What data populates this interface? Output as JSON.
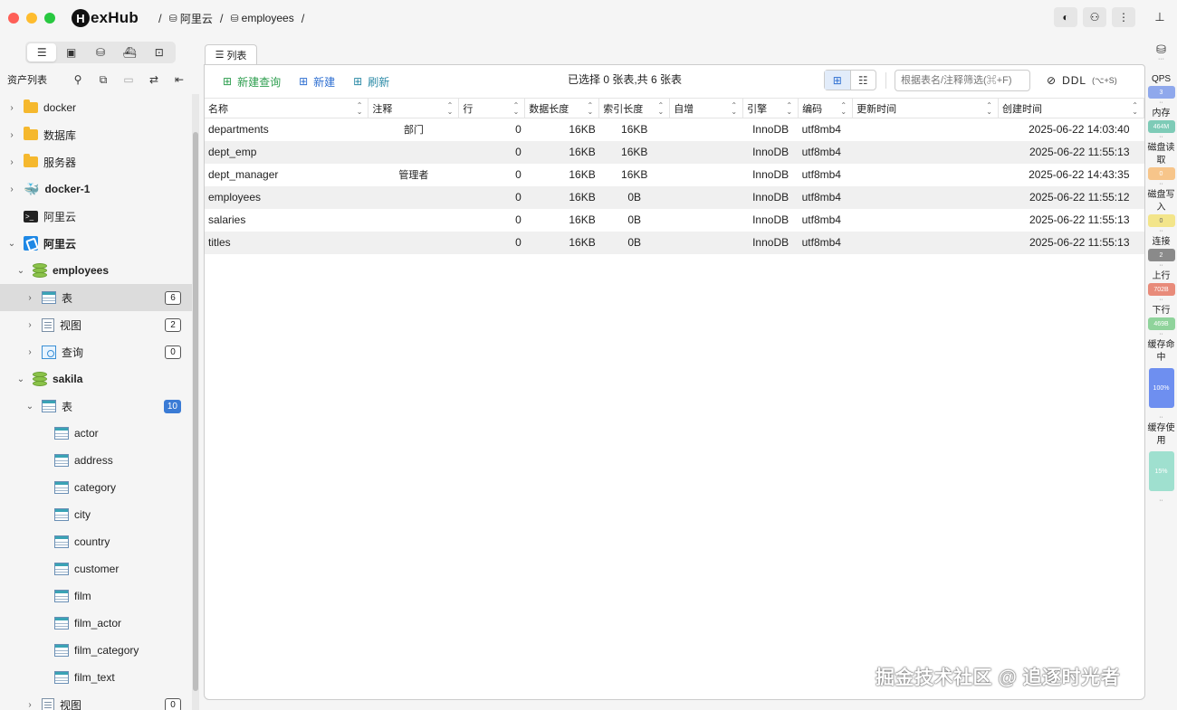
{
  "app": {
    "logo_letter": "H",
    "logo_rest": "exHub"
  },
  "breadcrumb": {
    "sep": "/",
    "item1": "阿里云",
    "item2": "employees"
  },
  "sidebar": {
    "header_label": "资产列表",
    "tree": [
      {
        "label": "docker",
        "icon": "folder",
        "chevron": "›",
        "level": 0,
        "bold": false
      },
      {
        "label": "数据库",
        "icon": "folder",
        "chevron": "›",
        "level": 0,
        "bold": false
      },
      {
        "label": "服务器",
        "icon": "folder",
        "chevron": "›",
        "level": 0,
        "bold": false
      },
      {
        "label": "docker-1",
        "icon": "docker",
        "chevron": "›",
        "level": 0,
        "bold": true
      },
      {
        "label": "阿里云",
        "icon": "terminal",
        "chevron": "",
        "level": 0,
        "bold": false
      },
      {
        "label": "阿里云",
        "icon": "aliyun",
        "chevron": "⌄",
        "level": 0,
        "bold": true
      },
      {
        "label": "employees",
        "icon": "database",
        "chevron": "⌄",
        "level": 1,
        "bold": true
      },
      {
        "label": "表",
        "icon": "table",
        "chevron": "›",
        "level": 2,
        "bold": false,
        "badge": "6",
        "selected": true
      },
      {
        "label": "视图",
        "icon": "view",
        "chevron": "›",
        "level": 2,
        "bold": false,
        "badge": "2"
      },
      {
        "label": "查询",
        "icon": "query",
        "chevron": "›",
        "level": 2,
        "bold": false,
        "badge": "0"
      },
      {
        "label": "sakila",
        "icon": "database",
        "chevron": "⌄",
        "level": 1,
        "bold": true
      },
      {
        "label": "表",
        "icon": "table",
        "chevron": "⌄",
        "level": 2,
        "bold": false,
        "badge": "10",
        "badge_blue": true
      },
      {
        "label": "actor",
        "icon": "table",
        "chevron": "",
        "level": 3,
        "bold": false
      },
      {
        "label": "address",
        "icon": "table",
        "chevron": "",
        "level": 3,
        "bold": false
      },
      {
        "label": "category",
        "icon": "table",
        "chevron": "",
        "level": 3,
        "bold": false
      },
      {
        "label": "city",
        "icon": "table",
        "chevron": "",
        "level": 3,
        "bold": false
      },
      {
        "label": "country",
        "icon": "table",
        "chevron": "",
        "level": 3,
        "bold": false
      },
      {
        "label": "customer",
        "icon": "table",
        "chevron": "",
        "level": 3,
        "bold": false
      },
      {
        "label": "film",
        "icon": "table",
        "chevron": "",
        "level": 3,
        "bold": false
      },
      {
        "label": "film_actor",
        "icon": "table",
        "chevron": "",
        "level": 3,
        "bold": false
      },
      {
        "label": "film_category",
        "icon": "table",
        "chevron": "",
        "level": 3,
        "bold": false
      },
      {
        "label": "film_text",
        "icon": "table",
        "chevron": "",
        "level": 3,
        "bold": false
      },
      {
        "label": "视图",
        "icon": "view",
        "chevron": "›",
        "level": 2,
        "bold": false,
        "badge": "0"
      }
    ]
  },
  "tab": {
    "label": "列表"
  },
  "toolbar": {
    "new_query": "新建查询",
    "new": "新建",
    "refresh": "刷新",
    "selection_info": "已选择 0 张表,共 6 张表",
    "filter_placeholder": "根据表名/注释筛选(⌘+F)",
    "ddl": "DDL",
    "ddl_shortcut": "(⌥+S)"
  },
  "table": {
    "columns": [
      "名称",
      "注释",
      "行",
      "数据长度",
      "索引长度",
      "自增",
      "引擎",
      "编码",
      "更新时间",
      "创建时间"
    ],
    "rows": [
      [
        "departments",
        "部门",
        "0",
        "16KB",
        "16KB",
        "",
        "InnoDB",
        "utf8mb4",
        "",
        "2025-06-22 14:03:40"
      ],
      [
        "dept_emp",
        "",
        "0",
        "16KB",
        "16KB",
        "",
        "InnoDB",
        "utf8mb4",
        "",
        "2025-06-22 11:55:13"
      ],
      [
        "dept_manager",
        "管理者",
        "0",
        "16KB",
        "16KB",
        "",
        "InnoDB",
        "utf8mb4",
        "",
        "2025-06-22 14:43:35"
      ],
      [
        "employees",
        "",
        "0",
        "16KB",
        "0B",
        "",
        "InnoDB",
        "utf8mb4",
        "",
        "2025-06-22 11:55:12"
      ],
      [
        "salaries",
        "",
        "0",
        "16KB",
        "0B",
        "",
        "InnoDB",
        "utf8mb4",
        "",
        "2025-06-22 11:55:13"
      ],
      [
        "titles",
        "",
        "0",
        "16KB",
        "0B",
        "",
        "InnoDB",
        "utf8mb4",
        "",
        "2025-06-22 11:55:13"
      ]
    ]
  },
  "monitor": [
    {
      "label": "QPS",
      "value": "3",
      "color": "#8fa8ec"
    },
    {
      "label": "内存",
      "value": "464M",
      "color": "#7ecbb7"
    },
    {
      "label": "磁盘读取",
      "value": "0",
      "color": "#f7c58a"
    },
    {
      "label": "磁盘写入",
      "value": "0",
      "color": "#f3e58a",
      "dark": true
    },
    {
      "label": "连接",
      "value": "2",
      "color": "#8a8a8a"
    },
    {
      "label": "上行",
      "value": "702B",
      "color": "#e88b7a"
    },
    {
      "label": "下行",
      "value": "469B",
      "color": "#8fd39b"
    },
    {
      "label": "缓存命中",
      "value": "100%",
      "color": "#6e8ff0",
      "tall": true
    },
    {
      "label": "缓存使用",
      "value": "15%",
      "color": "#9fe0cf",
      "tall": true
    }
  ],
  "watermark": "掘金技术社区 @ 追逐时光者"
}
